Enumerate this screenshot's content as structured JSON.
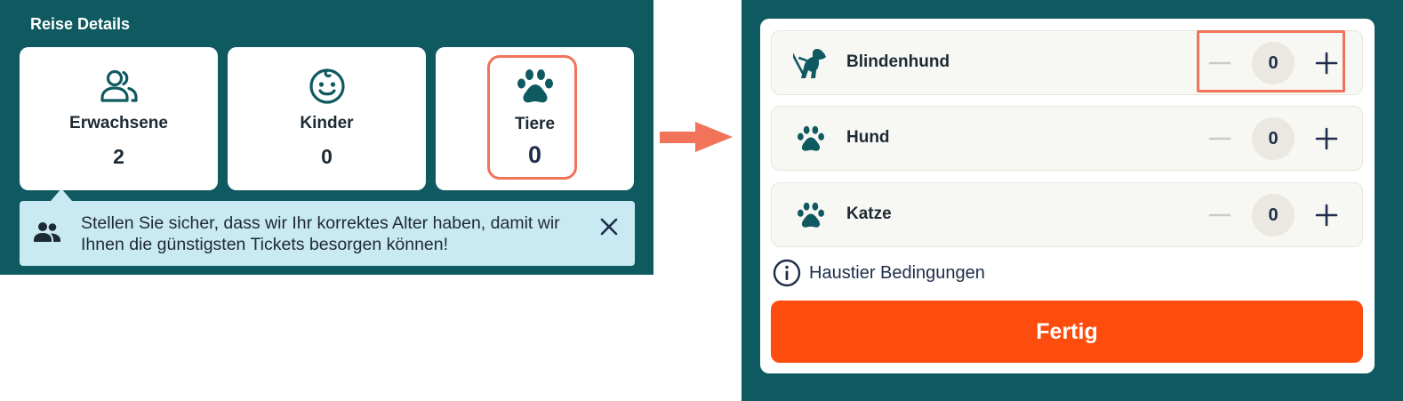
{
  "left": {
    "section_title": "Reise Details",
    "cards": [
      {
        "label": "Erwachsene",
        "count": "2",
        "icon": "adults-icon"
      },
      {
        "label": "Kinder",
        "count": "0",
        "icon": "child-face-icon"
      },
      {
        "label": "Tiere",
        "count": "0",
        "icon": "paw-icon"
      }
    ],
    "info_banner": {
      "message": "Stellen Sie sicher, dass wir Ihr korrektes Alter haben, damit wir Ihnen die günstigsten Tickets besorgen können!",
      "icon": "people-icon",
      "close_icon": "close-icon"
    }
  },
  "arrow_icon": "arrow-right-icon",
  "right": {
    "rows": [
      {
        "label": "Blindenhund",
        "value": "0",
        "icon": "guide-dog-icon"
      },
      {
        "label": "Hund",
        "value": "0",
        "icon": "paw-icon"
      },
      {
        "label": "Katze",
        "value": "0",
        "icon": "paw-icon"
      }
    ],
    "terms_label": "Haustier Bedingungen",
    "done_label": "Fertig"
  },
  "colors": {
    "panel_bg": "#0f5a60",
    "accent_orange": "#fc4c0e",
    "highlight": "#f0735a",
    "banner_bg": "#c9e9f3",
    "text_navy": "#1f2d4a"
  }
}
